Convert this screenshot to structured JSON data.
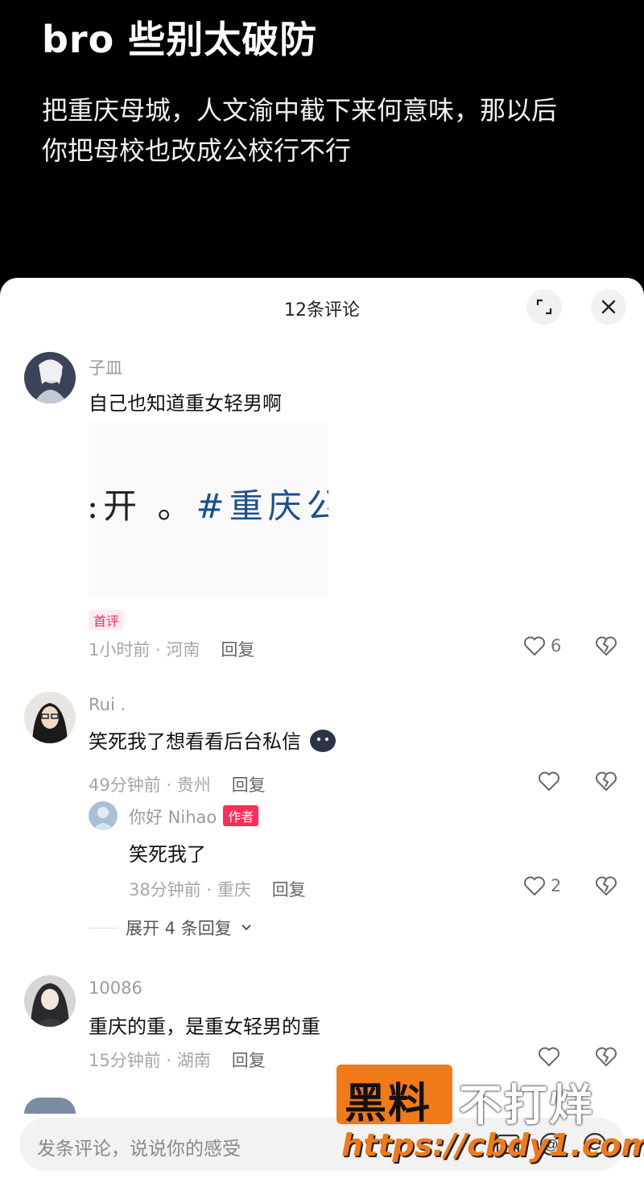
{
  "post": {
    "title": "bro 些别太破防",
    "line1": "把重庆母城，人文渝中截下来何意味，那以后",
    "line2": "你把母校也改成公校行不行"
  },
  "sheet": {
    "comment_count": "12条评论"
  },
  "comments": [
    {
      "username": "子皿",
      "text": "自己也知道重女轻男啊",
      "image_text_dark": ":开 。",
      "image_text": "#重庆公",
      "badge": "首评",
      "time": "1小时前 · 河南",
      "reply": "回复",
      "likes": "6"
    },
    {
      "username": "Rui .",
      "text": "笑死我了想看看后台私信",
      "time": "49分钟前 · 贵州",
      "reply": "回复",
      "likes": ""
    },
    {
      "username": "10086",
      "text": "重庆的重，是重女轻男的重",
      "time": "15分钟前 · 湖南",
      "reply": "回复",
      "likes": ""
    }
  ],
  "reply": {
    "username": "你好 Nihao",
    "badge": "作者",
    "text": "笑死我了",
    "time": "38分钟前 · 重庆",
    "reply": "回复",
    "likes": "2"
  },
  "expand_replies": "展开 4 条回复",
  "input": {
    "placeholder": "发条评论，说说你的感受"
  },
  "watermark": {
    "box_text": "黑料",
    "right_text": "不打烊",
    "url": "https://cbdy1.com"
  },
  "colors": {
    "accent": "#ff2d55",
    "watermark_orange": "#f07a18"
  }
}
